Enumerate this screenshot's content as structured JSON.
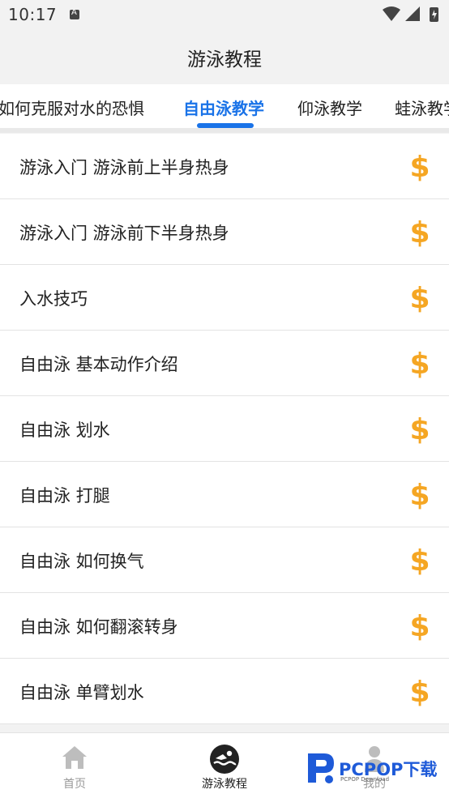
{
  "status_bar": {
    "time": "10:17"
  },
  "header": {
    "title": "游泳教程"
  },
  "tabs": [
    {
      "label": "如何克服对水的恐惧",
      "active": false
    },
    {
      "label": "自由泳教学",
      "active": true
    },
    {
      "label": "仰泳教学",
      "active": false
    },
    {
      "label": "蛙泳教学",
      "active": false
    }
  ],
  "list": {
    "items": [
      {
        "title": "游泳入门 游泳前上半身热身",
        "icon": "dollar-icon"
      },
      {
        "title": "游泳入门 游泳前下半身热身",
        "icon": "dollar-icon"
      },
      {
        "title": "入水技巧",
        "icon": "dollar-icon"
      },
      {
        "title": "自由泳 基本动作介绍",
        "icon": "dollar-icon"
      },
      {
        "title": "自由泳 划水",
        "icon": "dollar-icon"
      },
      {
        "title": "自由泳 打腿",
        "icon": "dollar-icon"
      },
      {
        "title": "自由泳 如何换气",
        "icon": "dollar-icon"
      },
      {
        "title": "自由泳 如何翻滚转身",
        "icon": "dollar-icon"
      },
      {
        "title": "自由泳 单臂划水",
        "icon": "dollar-icon"
      }
    ]
  },
  "bottom_nav": [
    {
      "label": "首页",
      "icon": "home-icon",
      "active": false
    },
    {
      "label": "游泳教程",
      "icon": "swimmer-icon",
      "active": true
    },
    {
      "label": "我的",
      "icon": "person-icon",
      "active": false
    }
  ],
  "watermark": {
    "text": "PCPOP下载",
    "sub": "PCPOP Download"
  },
  "colors": {
    "accent": "#1a73e8",
    "dollar": "#f5a623"
  }
}
